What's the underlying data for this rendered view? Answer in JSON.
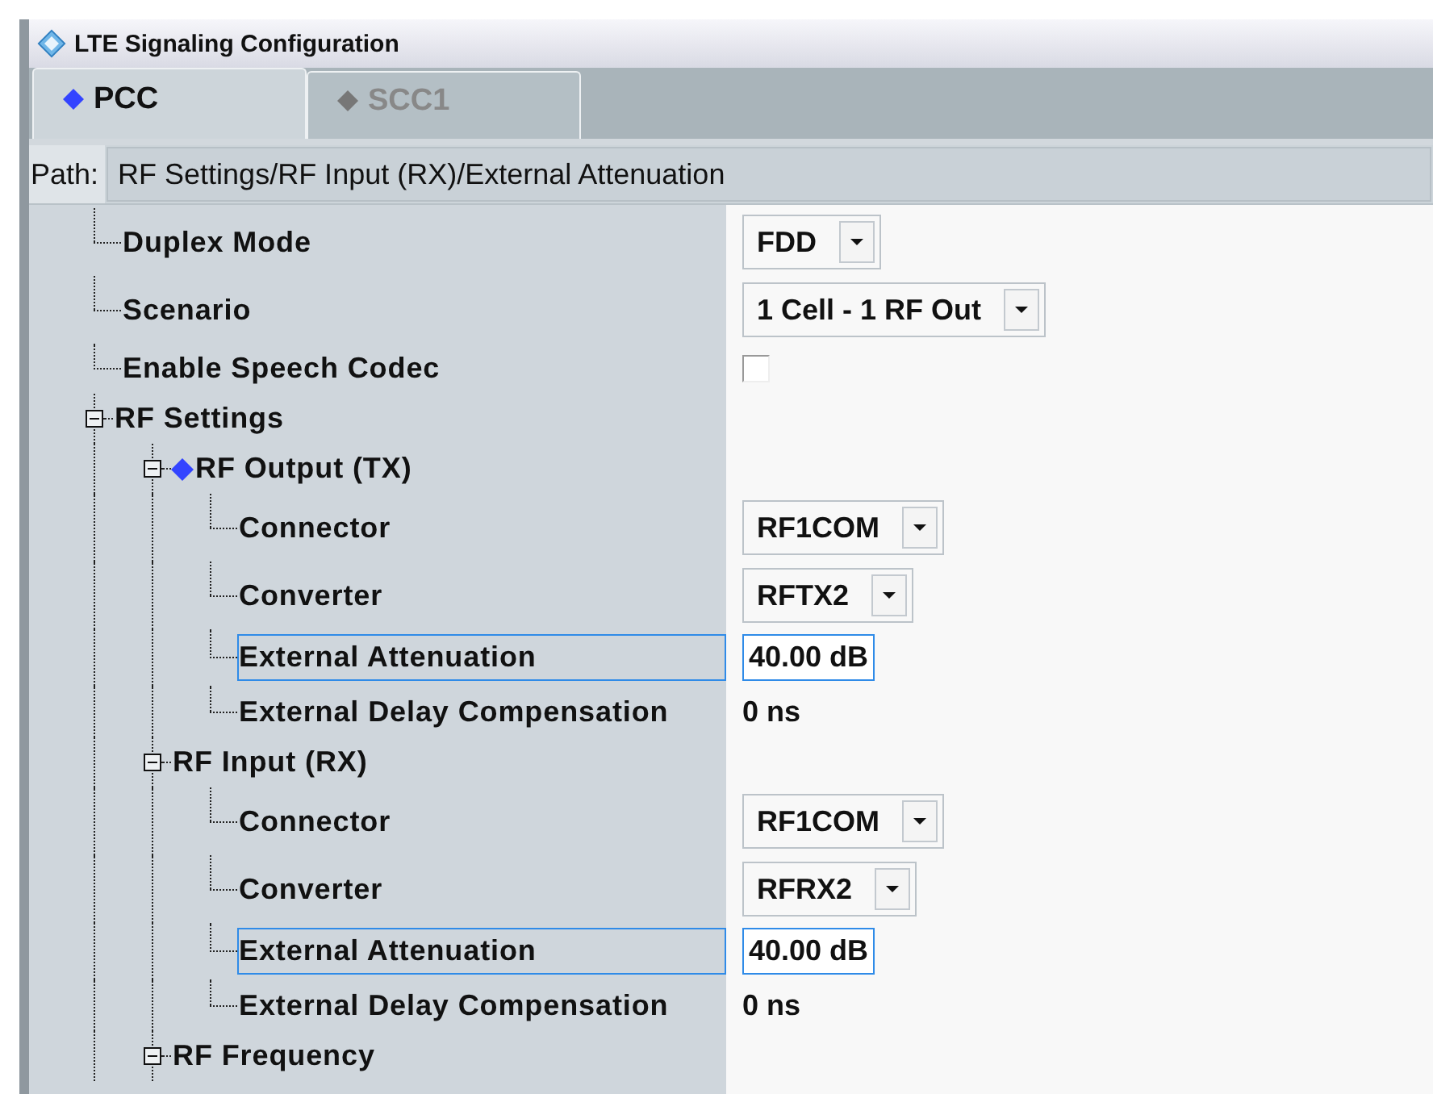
{
  "window": {
    "title": "LTE Signaling Configuration"
  },
  "tabs": [
    {
      "label": "PCC",
      "selected": true
    },
    {
      "label": "SCC1",
      "selected": false
    }
  ],
  "path": {
    "label": "Path:",
    "value": "RF Settings/RF Input (RX)/External Attenuation"
  },
  "tree": [
    {
      "kind": "dropdown",
      "label": "Duplex Mode",
      "value": "FDD",
      "selected": false
    },
    {
      "kind": "dropdown",
      "label": "Scenario",
      "value": "1 Cell - 1 RF Out",
      "selected": false
    },
    {
      "kind": "checkbox",
      "label": "Enable Speech Codec",
      "checked": false,
      "selected": false
    },
    {
      "kind": "group",
      "label": "RF Settings",
      "expanded": true,
      "selected": false,
      "children": [
        {
          "kind": "group",
          "label": "RF Output (TX)",
          "expanded": true,
          "flagged": true,
          "selected": false,
          "children": [
            {
              "kind": "dropdown",
              "label": "Connector",
              "value": "RF1COM",
              "selected": false
            },
            {
              "kind": "dropdown",
              "label": "Converter",
              "value": "RFTX2",
              "selected": false
            },
            {
              "kind": "number",
              "label": "External Attenuation",
              "value": "40.00 dB",
              "selected": true
            },
            {
              "kind": "text",
              "label": "External Delay Compensation",
              "value": "0 ns",
              "selected": false
            }
          ]
        },
        {
          "kind": "group",
          "label": "RF Input (RX)",
          "expanded": true,
          "selected": false,
          "children": [
            {
              "kind": "dropdown",
              "label": "Connector",
              "value": "RF1COM",
              "selected": false
            },
            {
              "kind": "dropdown",
              "label": "Converter",
              "value": "RFRX2",
              "selected": false
            },
            {
              "kind": "number",
              "label": "External Attenuation",
              "value": "40.00 dB",
              "selected": true
            },
            {
              "kind": "text",
              "label": "External Delay Compensation",
              "value": "0 ns",
              "selected": false
            }
          ]
        },
        {
          "kind": "group",
          "label": "RF Frequency",
          "expanded": true,
          "selected": false
        }
      ]
    }
  ]
}
